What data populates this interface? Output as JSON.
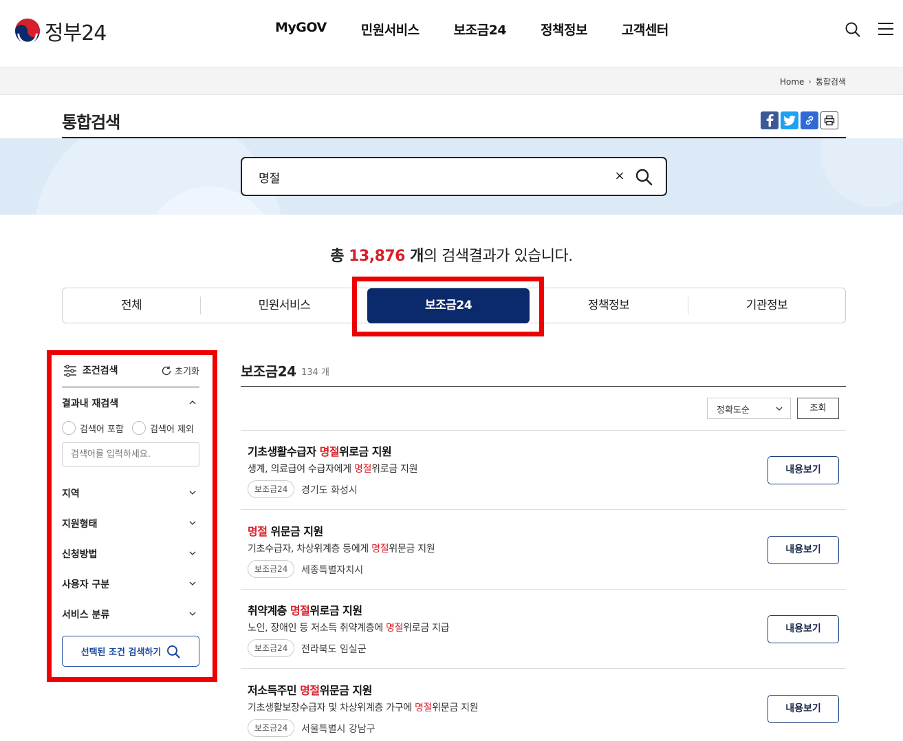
{
  "header": {
    "logo_text": "정부24",
    "nav": [
      "MyGOV",
      "민원서비스",
      "보조금24",
      "정책정보",
      "고객센터"
    ]
  },
  "breadcrumb": {
    "home": "Home",
    "current": "통합검색"
  },
  "page": {
    "title": "통합검색"
  },
  "search": {
    "value": "명절",
    "clear": "×"
  },
  "result_summary": {
    "prefix": "총 ",
    "count": "13,876",
    "unit": " 개",
    "suffix": "의 검색결과가 있습니다."
  },
  "tabs": [
    "전체",
    "민원서비스",
    "보조금24",
    "정책정보",
    "기관정보"
  ],
  "active_tab": "보조금24",
  "filter": {
    "title": "조건검색",
    "reset": "초기화",
    "refine_title": "결과내 재검색",
    "radio_include": "검색어 포함",
    "radio_exclude": "검색어 제외",
    "keyword_placeholder": "검색어를 입력하세요.",
    "sections": [
      "지역",
      "지원형태",
      "신청방법",
      "사용자 구분",
      "서비스 분류"
    ],
    "search_button": "선택된 조건 검색하기"
  },
  "results": {
    "section_title": "보조금24",
    "section_count": "134 개",
    "sort_value": "정확도순",
    "query_button": "조회",
    "items": [
      {
        "title_pre": "기초생활수급자 ",
        "title_hl": "명절",
        "title_post": "위로금 지원",
        "desc_pre": "생계, 의료급여 수급자에게 ",
        "desc_hl": "명절",
        "desc_post": "위로금 지원",
        "tag": "보조금24",
        "location": "경기도 화성시",
        "button": "내용보기"
      },
      {
        "title_pre": "",
        "title_hl": "명절",
        "title_post": " 위문금 지원",
        "desc_pre": "기초수급자, 차상위계층 등에게 ",
        "desc_hl": "명절",
        "desc_post": "위문금 지원",
        "tag": "보조금24",
        "location": "세종특별자치시",
        "button": "내용보기"
      },
      {
        "title_pre": "취약계층 ",
        "title_hl": "명절",
        "title_post": "위로금 지원",
        "desc_pre": "노인, 장애인 등 저소득 취약계층에 ",
        "desc_hl": "명절",
        "desc_post": "위로금 지급",
        "tag": "보조금24",
        "location": "전라북도 임실군",
        "button": "내용보기"
      },
      {
        "title_pre": "저소득주민 ",
        "title_hl": "명절",
        "title_post": "위문금 지원",
        "desc_pre": "기초생활보장수급자 및 차상위계층 가구에 ",
        "desc_hl": "명절",
        "desc_post": "위문금 지원",
        "tag": "보조금24",
        "location": "서울특별시 강남구",
        "button": "내용보기"
      }
    ]
  },
  "colors": {
    "brand_navy": "#0b2a6b",
    "highlight_red": "#d8202a",
    "annotation_red": "#ee0000",
    "band_blue": "#dceaf8"
  }
}
